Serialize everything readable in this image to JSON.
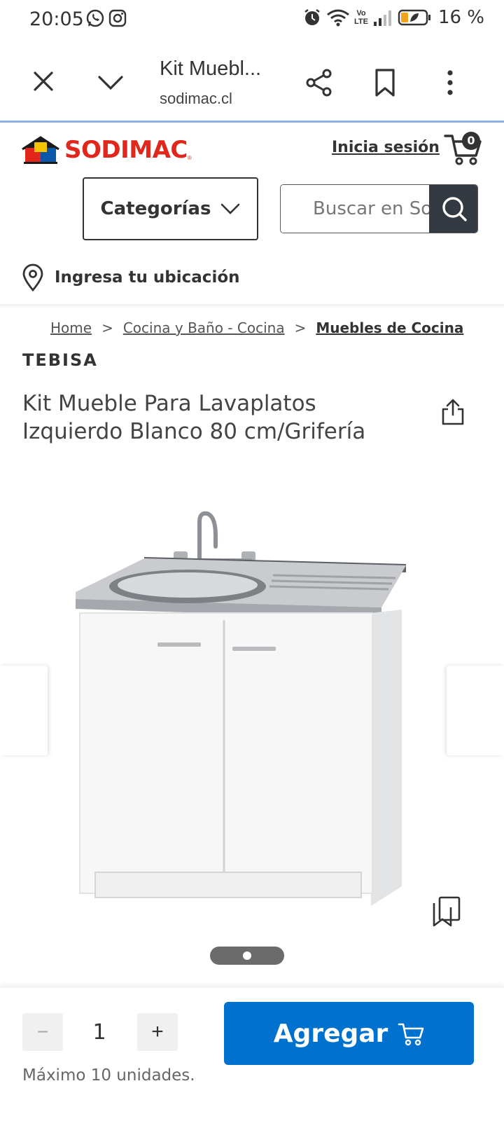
{
  "status_bar": {
    "time": "20:05",
    "volte_top": "Vo",
    "volte_bottom": "LTE",
    "battery": "16 %"
  },
  "browser": {
    "tab_title": "Kit Muebl...",
    "url": "sodimac.cl"
  },
  "header": {
    "logo_text": "SODIMAC",
    "logo_reg": "®",
    "login": "Inicia sesión",
    "cart_count": "0",
    "categories": "Categorías",
    "search_placeholder": "Buscar en Sodimac",
    "location": "Ingresa tu ubicación"
  },
  "breadcrumb": {
    "items": [
      "Home",
      "Cocina y Baño - Cocina",
      "Muebles de Cocina"
    ],
    "separator": ">"
  },
  "product": {
    "brand": "TEBISA",
    "title": "Kit Mueble Para Lavaplatos Izquierdo Blanco 80 cm/Grifería"
  },
  "purchase": {
    "minus": "−",
    "quantity": "1",
    "plus": "+",
    "add_label": "Agregar",
    "max_note": "Máximo 10 unidades."
  },
  "colors": {
    "brand_red": "#e1261c",
    "add_blue": "#0072ce",
    "search_button": "#333a41"
  }
}
